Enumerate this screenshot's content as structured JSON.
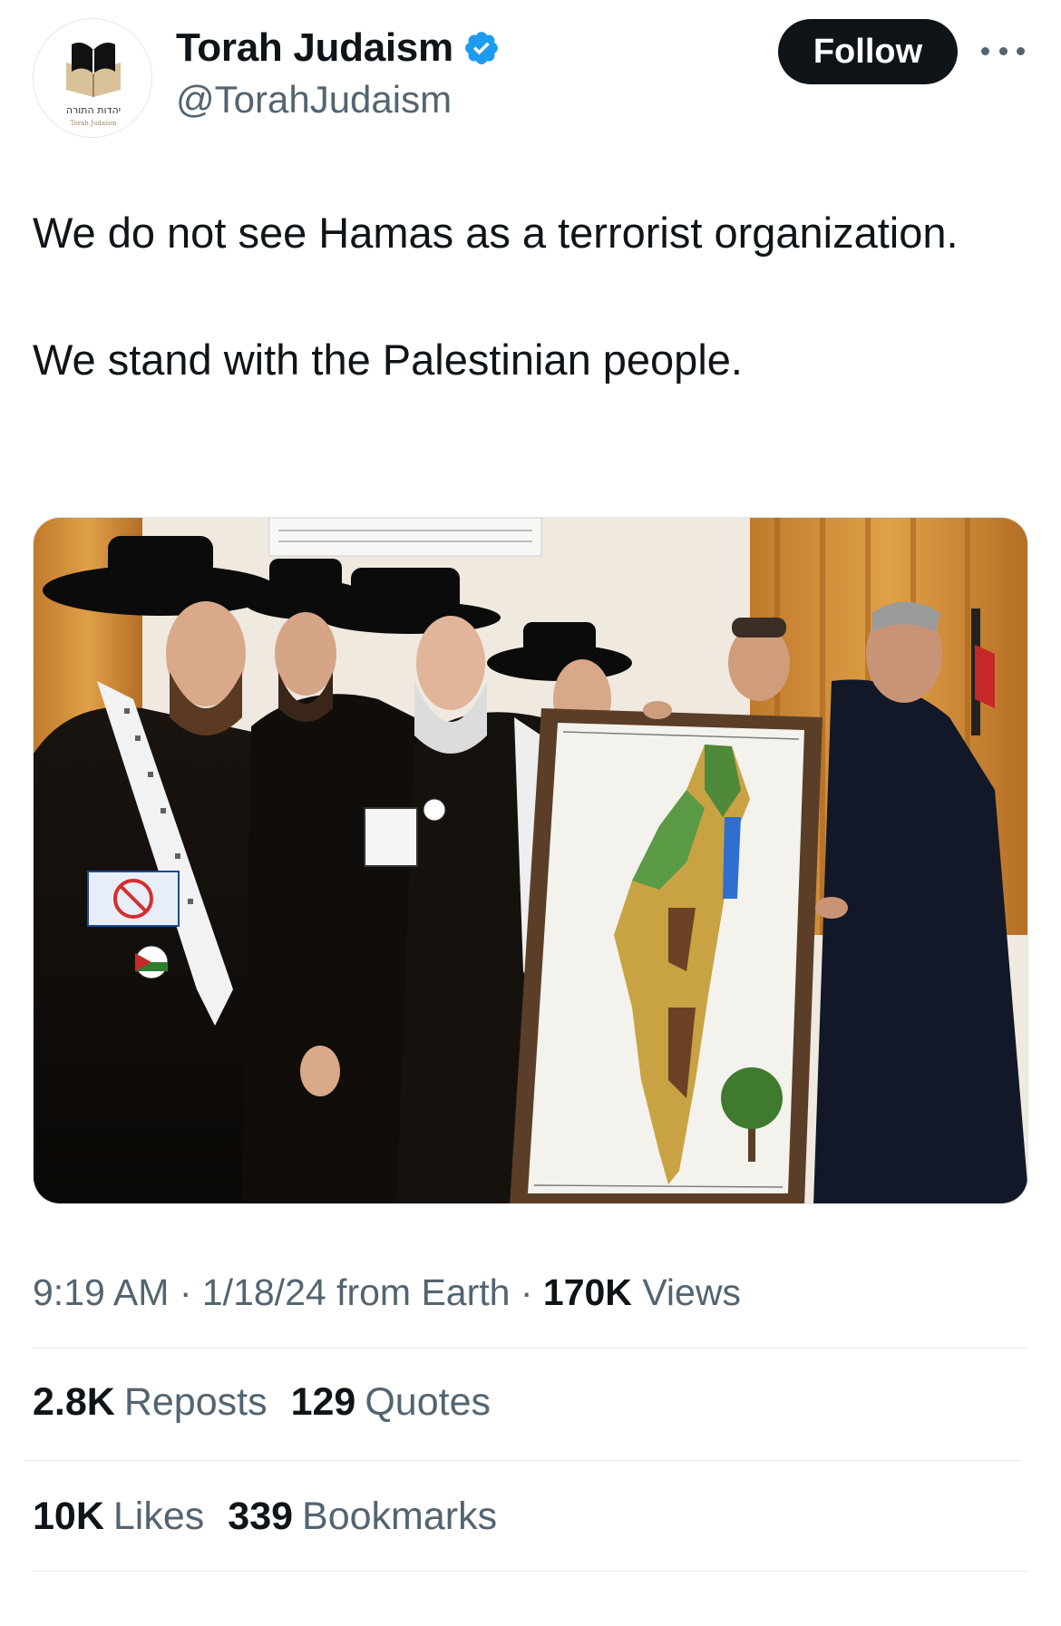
{
  "author": {
    "display_name": "Torah Judaism",
    "handle": "@TorahJudaism",
    "verified_icon": "verified-badge-icon",
    "avatar_hebrew": "יהדות התורה",
    "avatar_caption": "Torah Judaism"
  },
  "actions": {
    "follow_label": "Follow",
    "more_icon": "more-options-icon"
  },
  "tweet": {
    "line1": "We do not see Hamas as a terrorist organization.",
    "line2": "We stand with the Palestinian people."
  },
  "meta": {
    "time": "9:19 AM",
    "sep1": " · ",
    "date_source": "1/18/24 from Earth",
    "sep2": " · ",
    "views_count": "170K",
    "views_label": "Views"
  },
  "stats": {
    "reposts_count": "2.8K",
    "reposts_label": "Reposts",
    "quotes_count": "129",
    "quotes_label": "Quotes",
    "likes_count": "10K",
    "likes_label": "Likes",
    "bookmarks_count": "339",
    "bookmarks_label": "Bookmarks"
  },
  "colors": {
    "brand_blue": "#1d9bf0",
    "text_primary": "#0f1419",
    "text_secondary": "#536471",
    "follow_bg": "#0f1419"
  }
}
